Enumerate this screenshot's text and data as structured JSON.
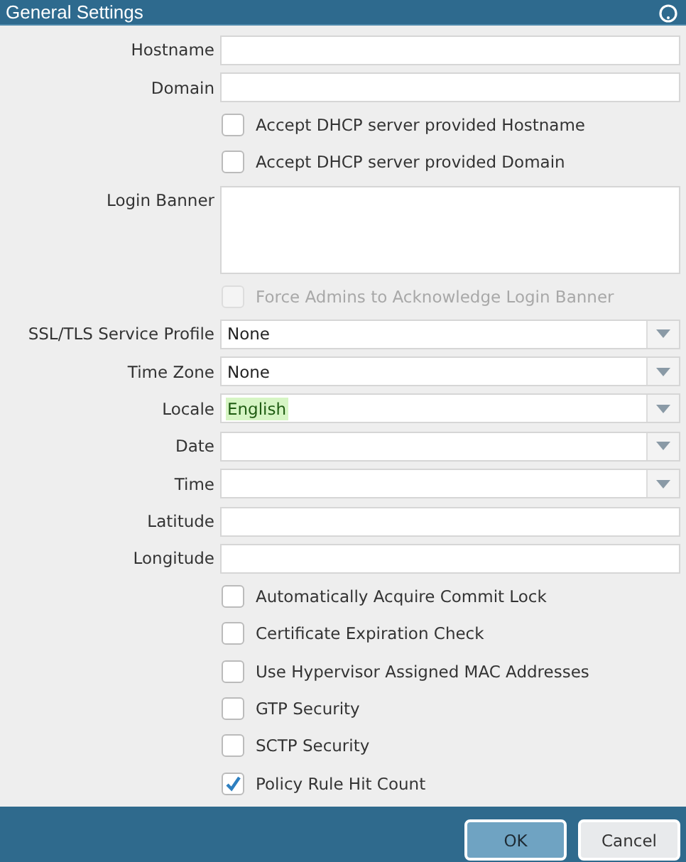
{
  "window": {
    "title": "General Settings"
  },
  "fields": [
    {
      "kind": "text",
      "label": "Hostname"
    },
    {
      "kind": "text",
      "label": "Domain"
    },
    {
      "kind": "checkbox",
      "label": "Accept DHCP server provided Hostname",
      "checked": false,
      "disabled": false
    },
    {
      "kind": "checkbox",
      "label": "Accept DHCP server provided Domain",
      "checked": false,
      "disabled": false
    },
    {
      "kind": "textarea",
      "label": "Login Banner"
    },
    {
      "kind": "checkbox",
      "label": "Force Admins to Acknowledge Login Banner",
      "checked": false,
      "disabled": true
    },
    {
      "kind": "select",
      "label": "SSL/TLS Service Profile",
      "value": "None",
      "highlighted": false
    },
    {
      "kind": "select",
      "label": "Time Zone",
      "value": "None",
      "highlighted": false
    },
    {
      "kind": "select",
      "label": "Locale",
      "value": "English",
      "highlighted": true
    },
    {
      "kind": "select",
      "label": "Date"
    },
    {
      "kind": "select",
      "label": "Time"
    },
    {
      "kind": "text",
      "label": "Latitude"
    },
    {
      "kind": "text",
      "label": "Longitude"
    },
    {
      "kind": "checkbox",
      "label": "Automatically Acquire Commit Lock",
      "checked": false,
      "disabled": false
    },
    {
      "kind": "checkbox",
      "label": "Certificate Expiration Check",
      "checked": false,
      "disabled": false
    },
    {
      "kind": "checkbox",
      "label": "Use Hypervisor Assigned MAC Addresses",
      "checked": false,
      "disabled": false
    },
    {
      "kind": "checkbox",
      "label": "GTP Security",
      "checked": false,
      "disabled": false
    },
    {
      "kind": "checkbox",
      "label": "SCTP Security",
      "checked": false,
      "disabled": false
    },
    {
      "kind": "checkbox",
      "label": "Policy Rule Hit Count",
      "checked": true,
      "disabled": false
    }
  ],
  "buttons": [
    {
      "label": "OK",
      "kind": "primary"
    },
    {
      "label": "Cancel",
      "kind": "secondary"
    }
  ]
}
